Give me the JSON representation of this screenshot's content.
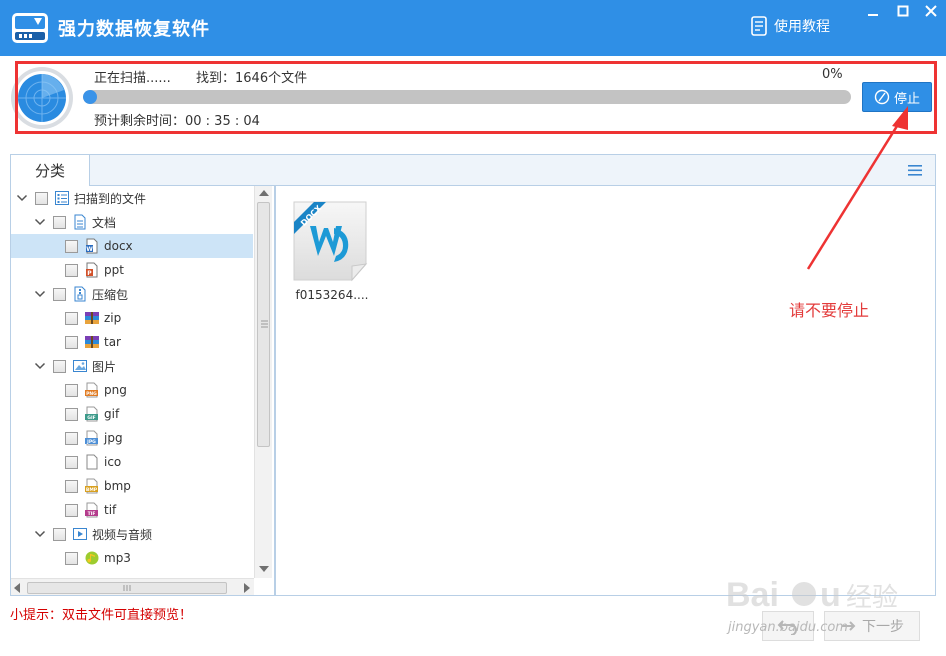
{
  "app": {
    "title": "强力数据恢复软件",
    "tutorial_label": "使用教程"
  },
  "scan": {
    "status": "正在扫描......",
    "found": "找到：1646个文件",
    "percent_label": "0%",
    "progress_fraction": 0.01,
    "remaining": "预计剩余时间：00 : 35 : 04",
    "stop_label": "停止"
  },
  "tabs": {
    "category": "分类"
  },
  "tree": [
    {
      "label": "扫描到的文件",
      "level": 0,
      "icon": "list-icon",
      "expanded": true
    },
    {
      "label": "文档",
      "level": 1,
      "icon": "document-icon",
      "expanded": true
    },
    {
      "label": "docx",
      "level": 2,
      "icon": "word-file-icon",
      "selected": true
    },
    {
      "label": "ppt",
      "level": 2,
      "icon": "ppt-file-icon"
    },
    {
      "label": "压缩包",
      "level": 1,
      "icon": "archive-icon",
      "expanded": true
    },
    {
      "label": "zip",
      "level": 2,
      "icon": "zip-file-icon"
    },
    {
      "label": "tar",
      "level": 2,
      "icon": "tar-file-icon"
    },
    {
      "label": "图片",
      "level": 1,
      "icon": "image-icon",
      "expanded": true
    },
    {
      "label": "png",
      "level": 2,
      "icon": "png-file-icon"
    },
    {
      "label": "gif",
      "level": 2,
      "icon": "gif-file-icon"
    },
    {
      "label": "jpg",
      "level": 2,
      "icon": "jpg-file-icon"
    },
    {
      "label": "ico",
      "level": 2,
      "icon": "blank-file-icon"
    },
    {
      "label": "bmp",
      "level": 2,
      "icon": "bmp-file-icon"
    },
    {
      "label": "tif",
      "level": 2,
      "icon": "tif-file-icon"
    },
    {
      "label": "视频与音频",
      "level": 1,
      "icon": "video-icon",
      "expanded": true
    },
    {
      "label": "mp3",
      "level": 2,
      "icon": "mp3-file-icon"
    }
  ],
  "files": [
    {
      "name": "f0153264....",
      "badge": "DOCX",
      "icon": "word-document-icon"
    }
  ],
  "annotation": {
    "text": "请不要停止"
  },
  "footer": {
    "tip": "小提示：双击文件可直接预览！",
    "next_label": "下一步"
  },
  "watermark": {
    "text": "jingyan.baidu.com"
  },
  "colors": {
    "titlebar": "#2f8fe6",
    "accent": "#3a93e8",
    "annotation_red": "#e33b3b",
    "tip_red": "#d40000"
  }
}
